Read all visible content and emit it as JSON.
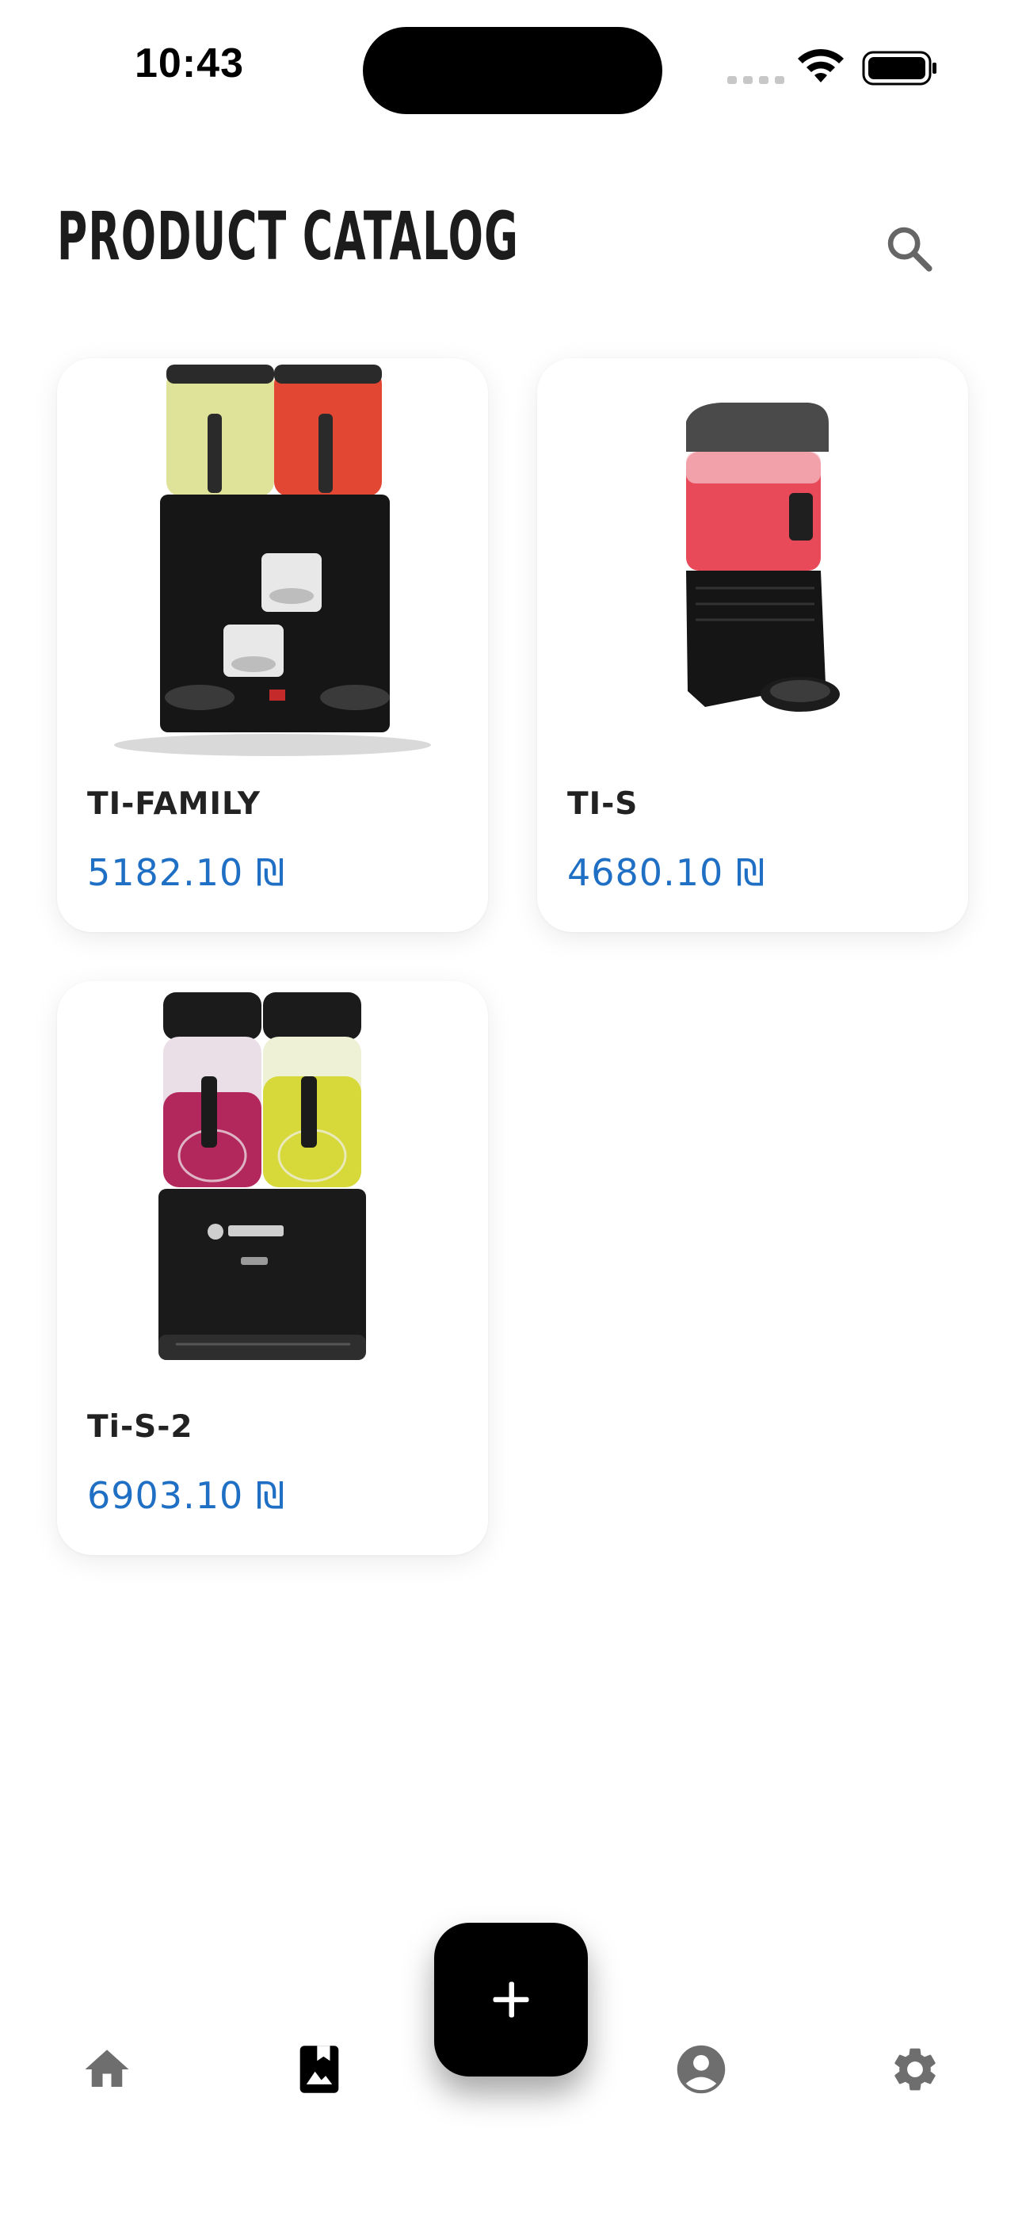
{
  "status_bar": {
    "time": "10:43"
  },
  "header": {
    "title": "PRODUCT CATALOG",
    "search_icon": "search-icon"
  },
  "products": [
    {
      "name": "TI-FAMILY",
      "price": "5182.10 ₪"
    },
    {
      "name": "TI-S",
      "price": "4680.10 ₪"
    },
    {
      "name": "Ti-S-2",
      "price": "6903.10 ₪"
    }
  ],
  "bottom_nav": {
    "items": [
      {
        "icon": "home-icon"
      },
      {
        "icon": "catalog-icon",
        "active": true
      },
      {
        "icon": "profile-icon"
      },
      {
        "icon": "settings-icon"
      }
    ],
    "fab_icon": "plus-icon"
  },
  "colors": {
    "price": "#1f6fc4",
    "title": "#1c1c1c",
    "nav_inactive": "#6e6e6e",
    "nav_active": "#000000",
    "fab": "#000000"
  }
}
